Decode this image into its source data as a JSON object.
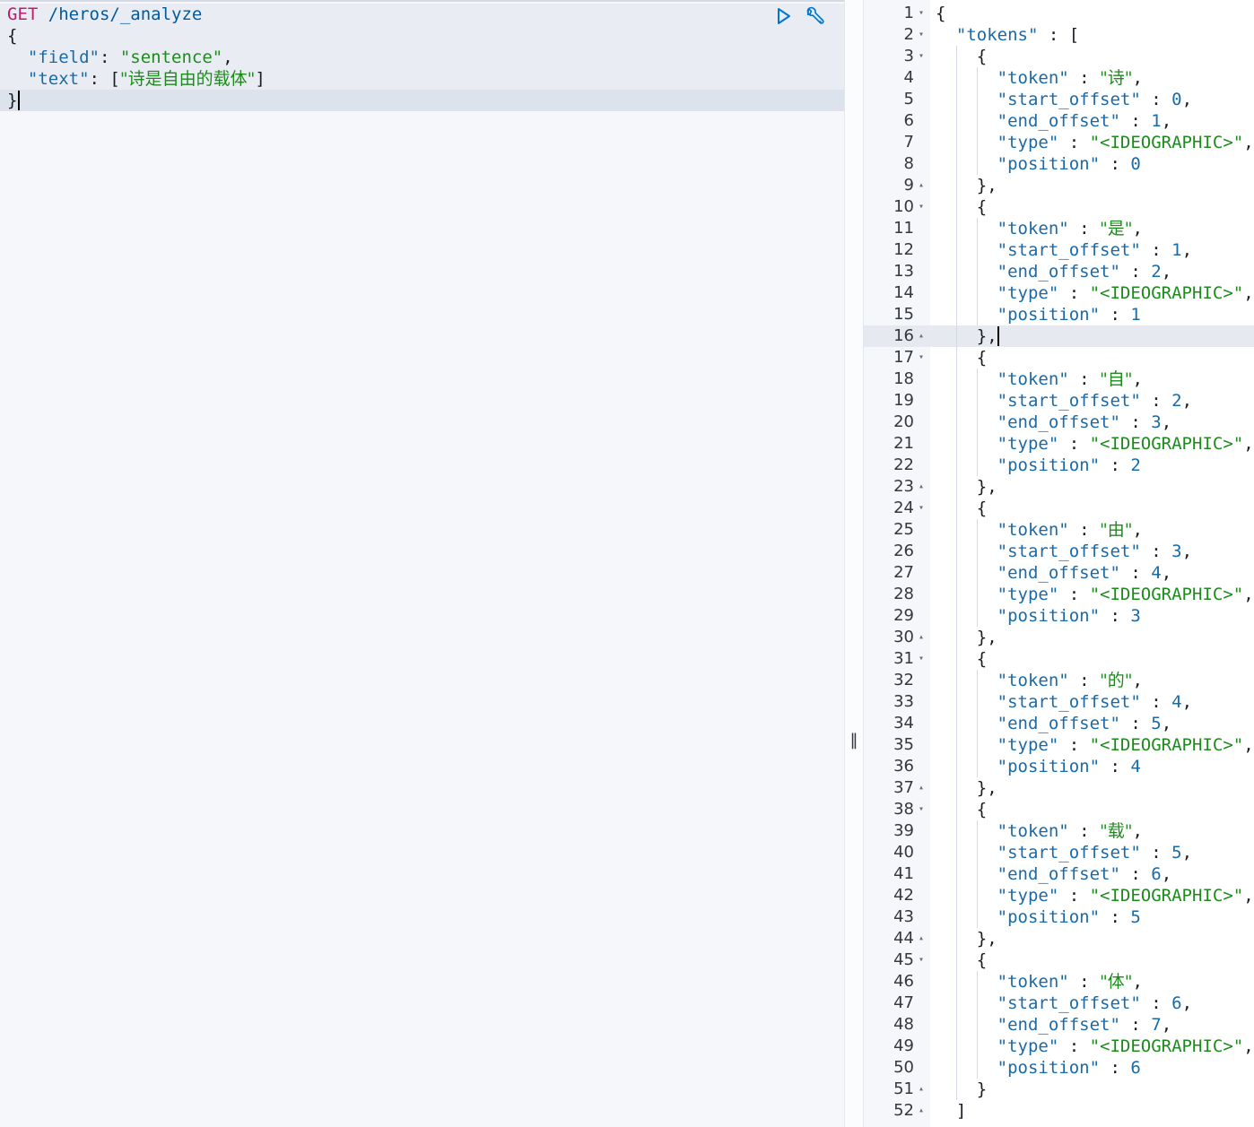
{
  "request": {
    "method": "GET",
    "path": "/heros/_analyze",
    "lines": [
      "{",
      "  \"field\": \"sentence\",",
      "  \"text\": [\"诗是自由的载体\"]",
      "}"
    ],
    "field_key": "\"field\"",
    "field_value": "\"sentence\"",
    "text_key": "\"text\"",
    "text_value": "\"诗是自由的载体\""
  },
  "actions": {
    "run_icon": "play-icon",
    "settings_icon": "wrench-icon"
  },
  "splitter": {
    "glyph": "‖"
  },
  "response": {
    "active_line": 16,
    "lines": [
      {
        "n": "1",
        "fold": "▾",
        "text": "{"
      },
      {
        "n": "2",
        "fold": "▾",
        "text": "  \"tokens\" : ["
      },
      {
        "n": "3",
        "fold": "▾",
        "text": "    {"
      },
      {
        "n": "4",
        "fold": "",
        "text": "      \"token\" : \"诗\","
      },
      {
        "n": "5",
        "fold": "",
        "text": "      \"start_offset\" : 0,"
      },
      {
        "n": "6",
        "fold": "",
        "text": "      \"end_offset\" : 1,"
      },
      {
        "n": "7",
        "fold": "",
        "text": "      \"type\" : \"<IDEOGRAPHIC>\","
      },
      {
        "n": "8",
        "fold": "",
        "text": "      \"position\" : 0"
      },
      {
        "n": "9",
        "fold": "▴",
        "text": "    },"
      },
      {
        "n": "10",
        "fold": "▾",
        "text": "    {"
      },
      {
        "n": "11",
        "fold": "",
        "text": "      \"token\" : \"是\","
      },
      {
        "n": "12",
        "fold": "",
        "text": "      \"start_offset\" : 1,"
      },
      {
        "n": "13",
        "fold": "",
        "text": "      \"end_offset\" : 2,"
      },
      {
        "n": "14",
        "fold": "",
        "text": "      \"type\" : \"<IDEOGRAPHIC>\","
      },
      {
        "n": "15",
        "fold": "",
        "text": "      \"position\" : 1"
      },
      {
        "n": "16",
        "fold": "▴",
        "text": "    },"
      },
      {
        "n": "17",
        "fold": "▾",
        "text": "    {"
      },
      {
        "n": "18",
        "fold": "",
        "text": "      \"token\" : \"自\","
      },
      {
        "n": "19",
        "fold": "",
        "text": "      \"start_offset\" : 2,"
      },
      {
        "n": "20",
        "fold": "",
        "text": "      \"end_offset\" : 3,"
      },
      {
        "n": "21",
        "fold": "",
        "text": "      \"type\" : \"<IDEOGRAPHIC>\","
      },
      {
        "n": "22",
        "fold": "",
        "text": "      \"position\" : 2"
      },
      {
        "n": "23",
        "fold": "▴",
        "text": "    },"
      },
      {
        "n": "24",
        "fold": "▾",
        "text": "    {"
      },
      {
        "n": "25",
        "fold": "",
        "text": "      \"token\" : \"由\","
      },
      {
        "n": "26",
        "fold": "",
        "text": "      \"start_offset\" : 3,"
      },
      {
        "n": "27",
        "fold": "",
        "text": "      \"end_offset\" : 4,"
      },
      {
        "n": "28",
        "fold": "",
        "text": "      \"type\" : \"<IDEOGRAPHIC>\","
      },
      {
        "n": "29",
        "fold": "",
        "text": "      \"position\" : 3"
      },
      {
        "n": "30",
        "fold": "▴",
        "text": "    },"
      },
      {
        "n": "31",
        "fold": "▾",
        "text": "    {"
      },
      {
        "n": "32",
        "fold": "",
        "text": "      \"token\" : \"的\","
      },
      {
        "n": "33",
        "fold": "",
        "text": "      \"start_offset\" : 4,"
      },
      {
        "n": "34",
        "fold": "",
        "text": "      \"end_offset\" : 5,"
      },
      {
        "n": "35",
        "fold": "",
        "text": "      \"type\" : \"<IDEOGRAPHIC>\","
      },
      {
        "n": "36",
        "fold": "",
        "text": "      \"position\" : 4"
      },
      {
        "n": "37",
        "fold": "▴",
        "text": "    },"
      },
      {
        "n": "38",
        "fold": "▾",
        "text": "    {"
      },
      {
        "n": "39",
        "fold": "",
        "text": "      \"token\" : \"载\","
      },
      {
        "n": "40",
        "fold": "",
        "text": "      \"start_offset\" : 5,"
      },
      {
        "n": "41",
        "fold": "",
        "text": "      \"end_offset\" : 6,"
      },
      {
        "n": "42",
        "fold": "",
        "text": "      \"type\" : \"<IDEOGRAPHIC>\","
      },
      {
        "n": "43",
        "fold": "",
        "text": "      \"position\" : 5"
      },
      {
        "n": "44",
        "fold": "▴",
        "text": "    },"
      },
      {
        "n": "45",
        "fold": "▾",
        "text": "    {"
      },
      {
        "n": "46",
        "fold": "",
        "text": "      \"token\" : \"体\","
      },
      {
        "n": "47",
        "fold": "",
        "text": "      \"start_offset\" : 6,"
      },
      {
        "n": "48",
        "fold": "",
        "text": "      \"end_offset\" : 7,"
      },
      {
        "n": "49",
        "fold": "",
        "text": "      \"type\" : \"<IDEOGRAPHIC>\","
      },
      {
        "n": "50",
        "fold": "",
        "text": "      \"position\" : 6"
      },
      {
        "n": "51",
        "fold": "▴",
        "text": "    }"
      },
      {
        "n": "52",
        "fold": "▴",
        "text": "  ]"
      }
    ]
  }
}
